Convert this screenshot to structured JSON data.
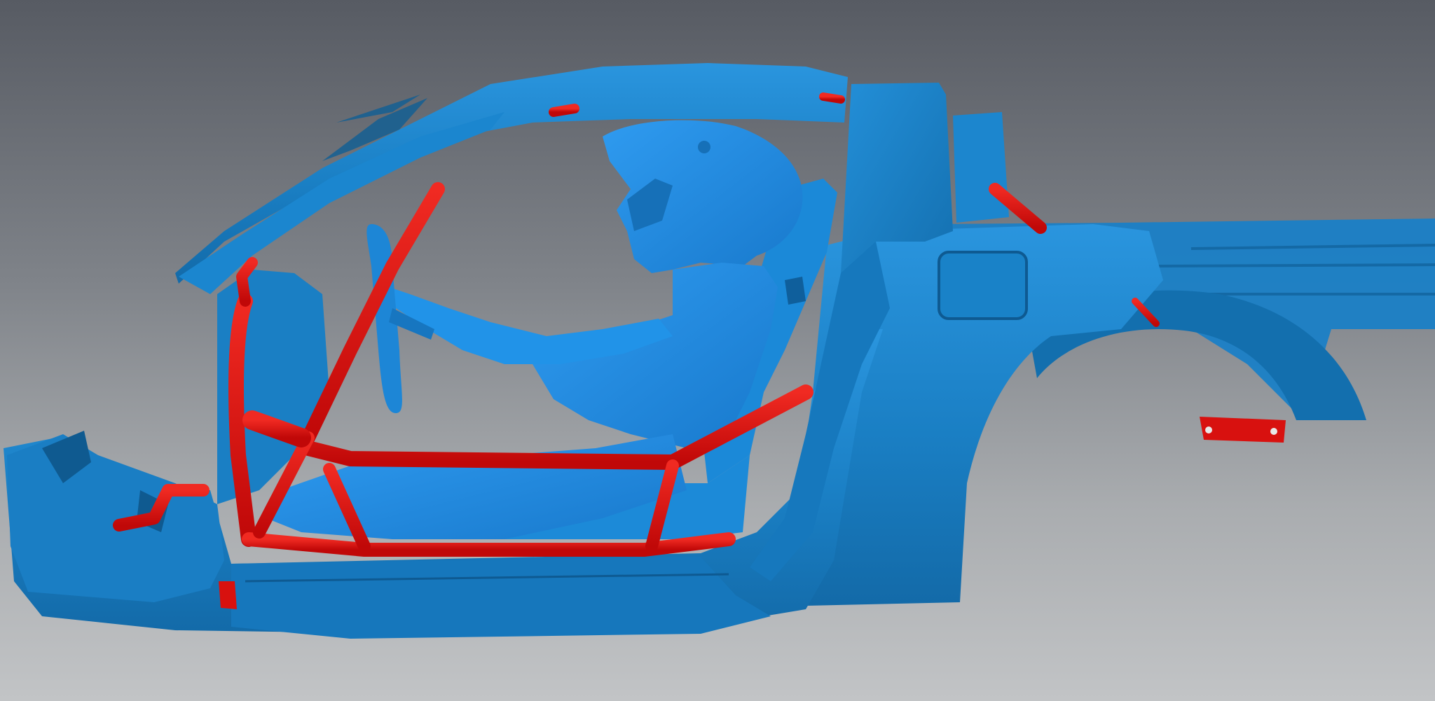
{
  "viewport": {
    "background_top": "#575b63",
    "background_bottom": "#c2c4c6"
  },
  "model": {
    "parts": [
      {
        "name": "car-body-shell",
        "color": "#1a86cf"
      },
      {
        "name": "driver-mannequin",
        "color": "#1f8ae0"
      },
      {
        "name": "racing-seat",
        "color": "#1a88d6"
      },
      {
        "name": "roll-cage",
        "color": "#e01313"
      }
    ]
  }
}
